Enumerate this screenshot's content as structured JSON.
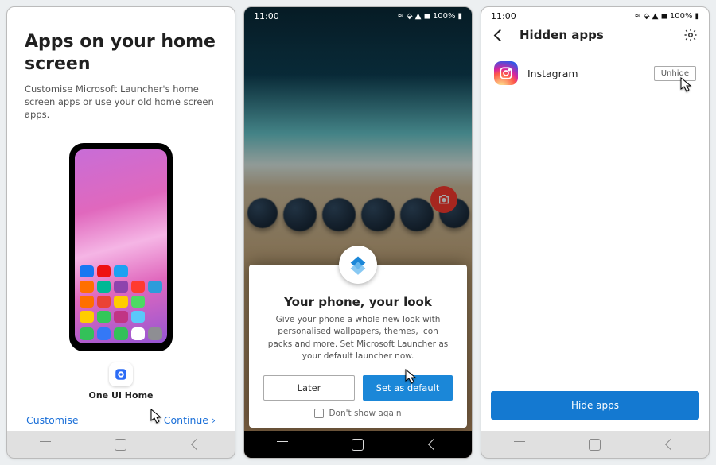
{
  "status": {
    "time": "11:00",
    "battery": "100%",
    "icons": "≈ ⬙ ▲ ◼"
  },
  "p1": {
    "title": "Apps on your home screen",
    "desc": "Customise Microsoft Launcher's home screen apps or use your old home screen apps.",
    "option_label": "One UI Home",
    "customise": "Customise",
    "continue": "Continue"
  },
  "p2": {
    "dialog_title": "Your phone, your look",
    "dialog_body": "Give your phone a whole new look with personalised wallpapers, themes, icon packs and more. Set Microsoft Launcher as your default launcher now.",
    "later": "Later",
    "set_default": "Set as default",
    "dont_show": "Don't show again"
  },
  "p3": {
    "title": "Hidden apps",
    "app_name": "Instagram",
    "unhide": "Unhide",
    "hide_apps": "Hide apps"
  }
}
